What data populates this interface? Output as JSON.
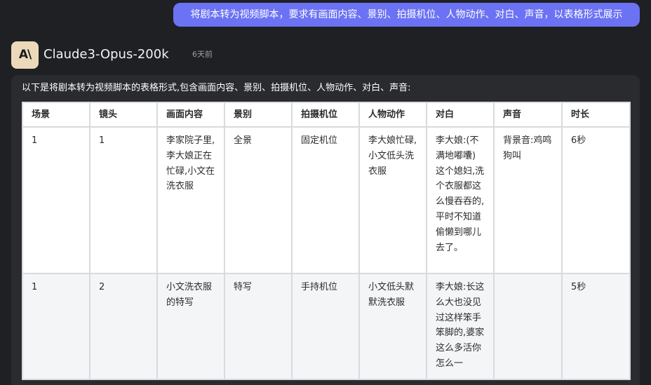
{
  "user_message": "将剧本转为视频脚本，要求有画面内容、景别、拍摄机位、人物动作、对白、声音，以表格形式展示",
  "assistant": {
    "avatar_text": "A\\",
    "model_name": "Claude3-Opus-200k",
    "timestamp": "6天前",
    "intro": "以下是将剧本转为视频脚本的表格形式,包含画面内容、景别、拍摄机位、人物动作、对白、声音:"
  },
  "table": {
    "headers": [
      "场景",
      "镜头",
      "画面内容",
      "景别",
      "拍摄机位",
      "人物动作",
      "对白",
      "声音",
      "时长"
    ],
    "rows": [
      [
        "1",
        "1",
        "李家院子里,李大娘正在忙碌,小文在洗衣服",
        "全景",
        "固定机位",
        "李大娘忙碌,小文低头洗衣服",
        "李大娘:(不满地嘟囔)这个媳妇,洗个衣服都这么慢吞吞的,平时不知道偷懒到哪儿去了。",
        "背景音:鸡鸣狗叫",
        "6秒"
      ],
      [
        "1",
        "2",
        "小文洗衣服的特写",
        "特写",
        "手持机位",
        "小文低头默默洗衣服",
        "李大娘:长这么大也没见过这样笨手笨脚的,婆家这么多活你怎么一",
        "",
        "5秒"
      ]
    ]
  },
  "colors": {
    "background": "#1f2023",
    "user_bubble": "#6b72f3",
    "card": "#2a2b2f",
    "avatar": "#ecd9ba"
  }
}
